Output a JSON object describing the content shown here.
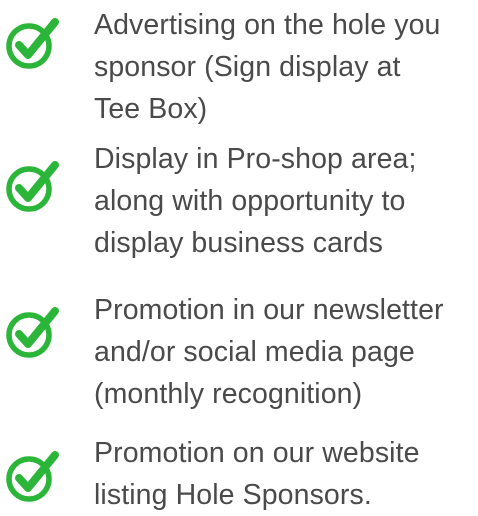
{
  "accent_color": "#2bb539",
  "text_color": "#4a4a4a",
  "benefits": [
    {
      "icon": "check-circle-icon",
      "text": "Advertising on the hole you\nsponsor (Sign display at\nTee Box)"
    },
    {
      "icon": "check-circle-icon",
      "text": "Display in Pro-shop area;\nalong with opportunity to\ndisplay business cards"
    },
    {
      "icon": "check-circle-icon",
      "text": "Promotion in our newsletter\nand/or social media page\n(monthly recognition)"
    },
    {
      "icon": "check-circle-icon",
      "text": "Promotion on our website\nlisting Hole Sponsors."
    }
  ]
}
